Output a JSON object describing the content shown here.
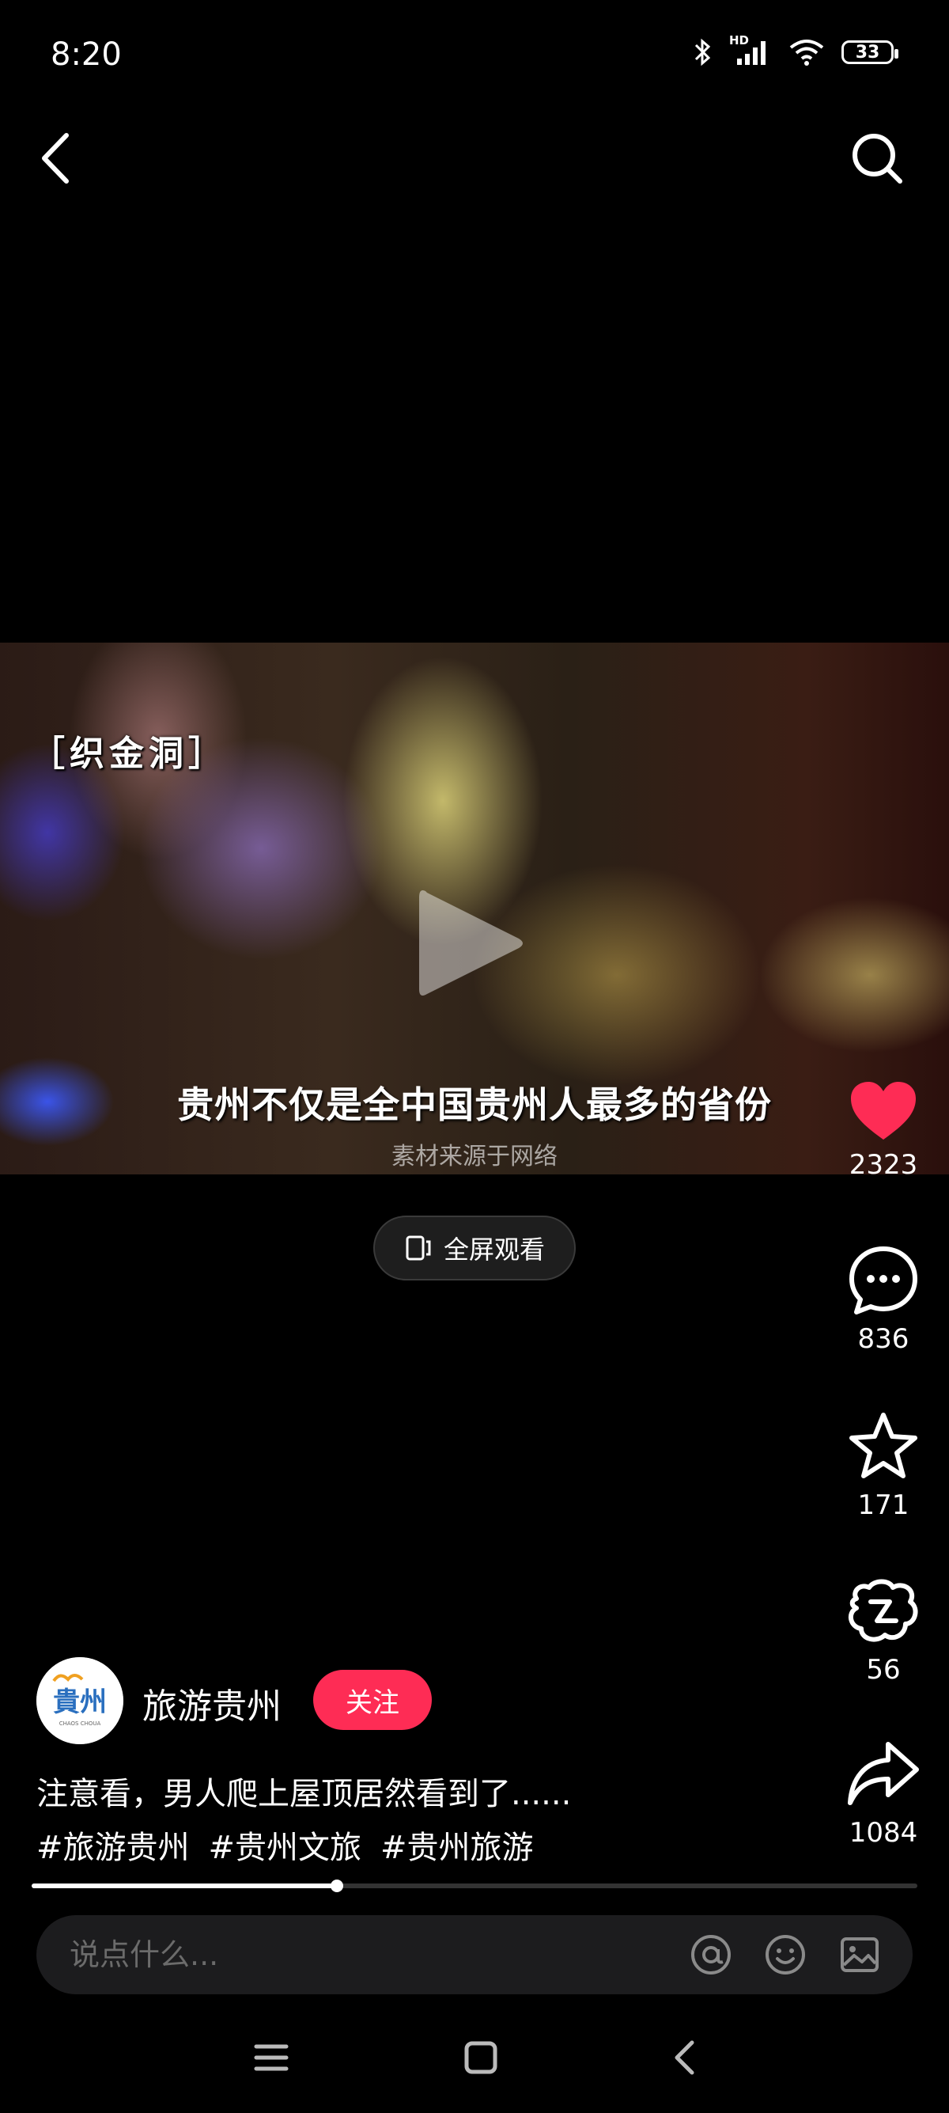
{
  "status_bar": {
    "time": "8:20",
    "network_label": "HD",
    "battery": "33",
    "icons": [
      "bluetooth-icon",
      "signal-icon",
      "wifi-icon",
      "battery-icon"
    ]
  },
  "nav": {
    "back_icon": "chevron-left-icon",
    "search_icon": "search-icon"
  },
  "video": {
    "overlay_title": "［织金洞］",
    "subtitle": "贵州不仅是全中国贵州人最多的省份",
    "source_note": "素材来源于网络",
    "play_icon": "play-icon"
  },
  "fullscreen_button": {
    "label": "全屏观看",
    "icon": "fullscreen-rotate-icon"
  },
  "actions": {
    "like": {
      "icon": "heart-icon",
      "count": "2323",
      "color": "#fe2c55"
    },
    "comment": {
      "icon": "comment-icon",
      "count": "836"
    },
    "favorite": {
      "icon": "star-icon",
      "count": "171"
    },
    "collab": {
      "icon": "collab-icon",
      "count": "56"
    },
    "share": {
      "icon": "share-icon",
      "count": "1084"
    }
  },
  "author": {
    "name": "旅游贵州",
    "follow_label": "关注",
    "follow_color": "#fe2c55",
    "avatar_text": "貴州",
    "avatar_subtext": "CHAOS CHOUA"
  },
  "caption": "注意看，男人爬上屋顶居然看到了......",
  "hashtags": [
    "#旅游贵州",
    "#贵州文旅",
    "#贵州旅游"
  ],
  "progress": {
    "fraction": 0.345
  },
  "comment_bar": {
    "placeholder": "说点什么...",
    "icons": [
      "at-icon",
      "emoji-icon",
      "image-icon"
    ]
  },
  "system_nav": {
    "icons": [
      "menu-icon",
      "home-square-icon",
      "back-chevron-icon"
    ]
  }
}
